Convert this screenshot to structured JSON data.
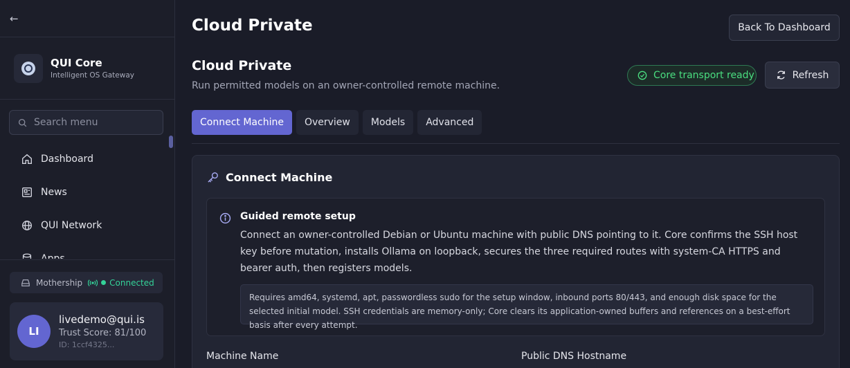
{
  "sidebar": {
    "back_icon": "arrow-left-icon",
    "brand": {
      "name": "QUI Core",
      "subtitle": "Intelligent OS Gateway"
    },
    "search": {
      "placeholder": "Search menu"
    },
    "items": [
      {
        "label": "Dashboard",
        "icon": "home-icon"
      },
      {
        "label": "News",
        "icon": "newspaper-icon"
      },
      {
        "label": "QUI Network",
        "icon": "globe-icon"
      },
      {
        "label": "Apps",
        "icon": "database-icon"
      }
    ],
    "mothership": {
      "label": "Mothership",
      "status": "Connected"
    },
    "user": {
      "initials": "LI",
      "email": "livedemo@qui.is",
      "trust": "Trust Score: 81/100",
      "id": "ID: 1ccf4325..."
    }
  },
  "header": {
    "title": "Cloud Private",
    "back_button": "Back To Dashboard"
  },
  "section": {
    "title": "Cloud Private",
    "subtitle": "Run permitted models on an owner-controlled remote machine.",
    "status_badge": "Core transport ready",
    "refresh_button": "Refresh"
  },
  "tabs": [
    {
      "label": "Connect Machine",
      "active": true
    },
    {
      "label": "Overview",
      "active": false
    },
    {
      "label": "Models",
      "active": false
    },
    {
      "label": "Advanced",
      "active": false
    }
  ],
  "card": {
    "title": "Connect Machine",
    "info": {
      "title": "Guided remote setup",
      "body": "Connect an owner-controlled Debian or Ubuntu machine with public DNS pointing to it. Core confirms the SSH host key before mutation, installs Ollama on loopback, secures the three required routes with system-CA HTTPS and bearer auth, then registers models.",
      "requirements": "Requires amd64, systemd, apt, passwordless sudo for the setup window, inbound ports 80/443, and enough disk space for the selected initial model. SSH credentials are memory-only; Core clears its application-owned buffers and references on a best-effort basis after every attempt."
    },
    "fields": {
      "machine_name_label": "Machine Name",
      "dns_hostname_label": "Public DNS Hostname"
    }
  },
  "colors": {
    "accent": "#6366d1",
    "success": "#4ade80",
    "background": "#1a1c28"
  }
}
